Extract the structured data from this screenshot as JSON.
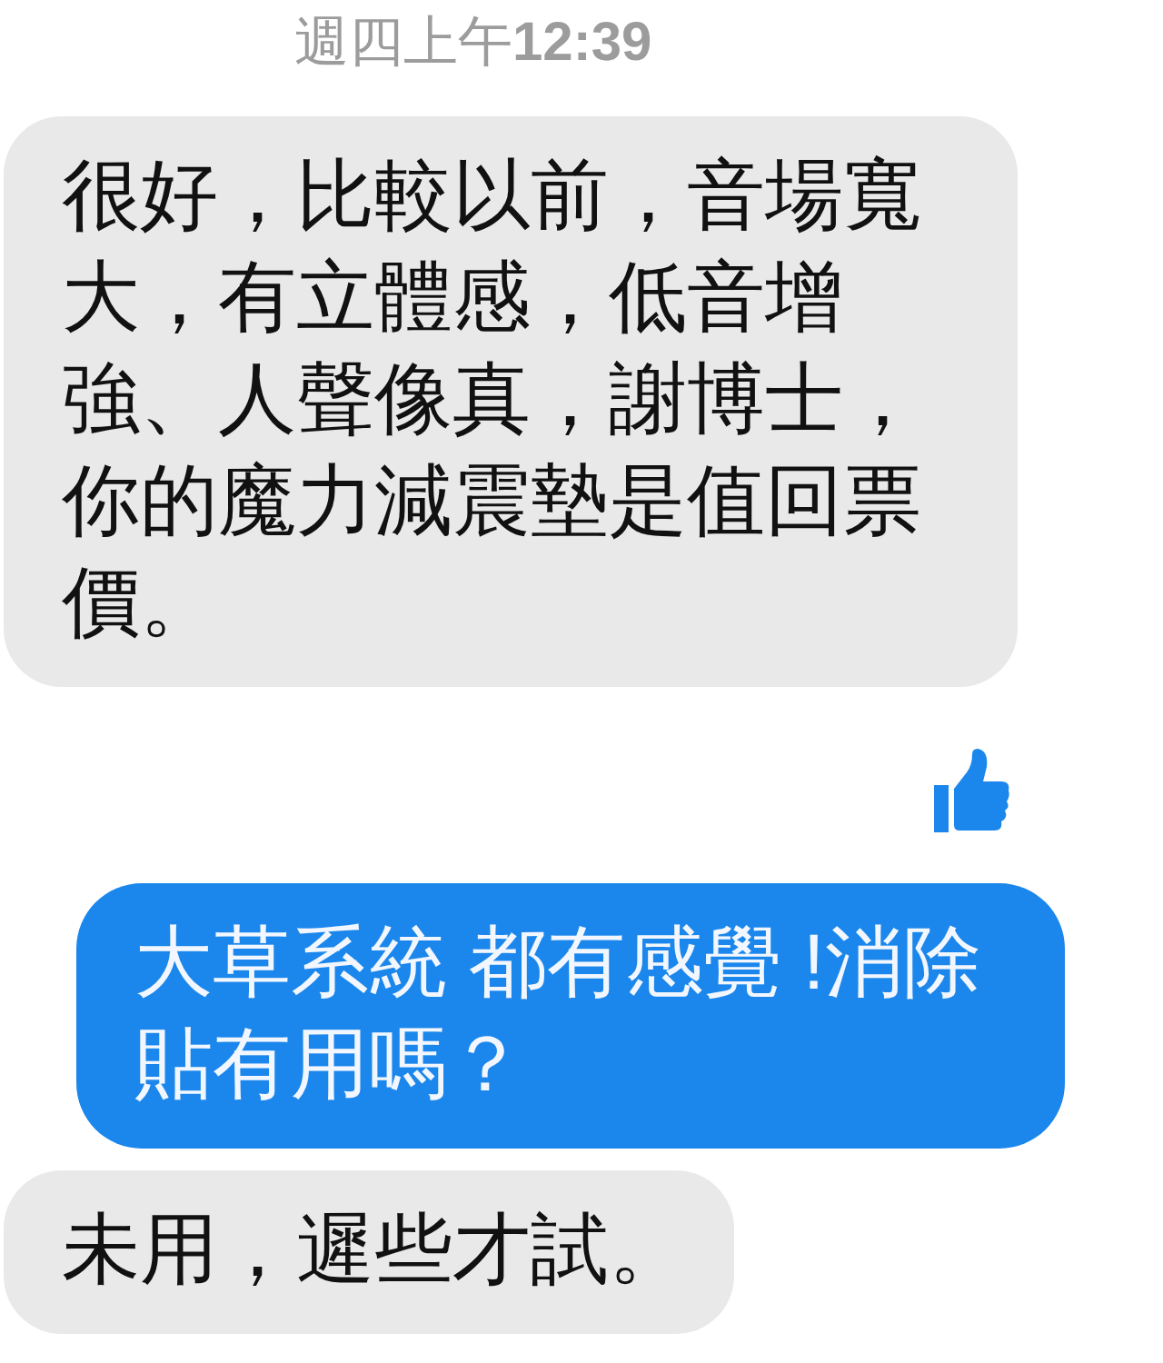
{
  "timestamp": "週四上午**12:39**",
  "messages": [
    {
      "kind": "received",
      "text": "很好，比較以前，音場寬大，有立體感，低音增強、人聲像真，謝博士，你的魔力減震墊是值回票價。"
    },
    {
      "kind": "like"
    },
    {
      "kind": "sent",
      "text": "大草系統 都有感覺 !消除貼有用嗎？"
    },
    {
      "kind": "received",
      "text": "未用，遲些才試。"
    }
  ]
}
